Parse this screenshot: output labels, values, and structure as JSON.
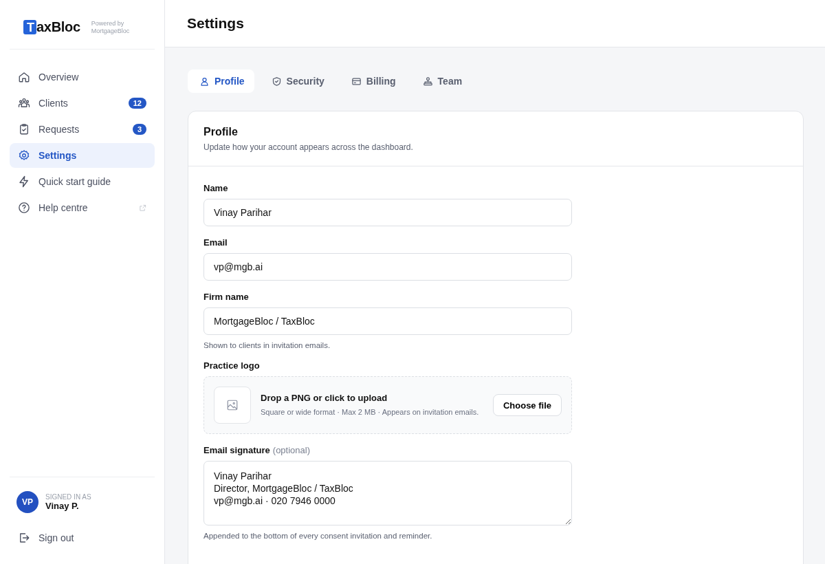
{
  "logo": {
    "mark": "T",
    "text": "axBloc",
    "powered_by": "Powered by",
    "powered_name": "MortgageBloc"
  },
  "nav": [
    {
      "label": "Overview",
      "selected": false,
      "external": false
    },
    {
      "label": "Clients",
      "badge": "12",
      "selected": false,
      "external": false
    },
    {
      "label": "Requests",
      "badge": "3",
      "selected": false,
      "external": false
    },
    {
      "label": "Settings",
      "selected": true,
      "external": false
    },
    {
      "label": "Quick start guide",
      "selected": false,
      "external": false
    },
    {
      "label": "Help centre",
      "selected": false,
      "external": true
    }
  ],
  "user": {
    "initials": "VP",
    "caption": "SIGNED IN AS",
    "name": "Vinay P."
  },
  "sign_out": "Sign out",
  "page_title": "Settings",
  "tabs": [
    {
      "label": "Profile",
      "selected": true
    },
    {
      "label": "Security",
      "selected": false
    },
    {
      "label": "Billing",
      "selected": false
    },
    {
      "label": "Team",
      "selected": false
    }
  ],
  "card": {
    "title": "Profile",
    "subtitle": "Update how your account appears across the dashboard."
  },
  "fields": [
    {
      "kind": "input",
      "label": "Name",
      "value": "Vinay Parihar"
    },
    {
      "kind": "input",
      "label": "Email",
      "value": "vp@mgb.ai"
    },
    {
      "kind": "input",
      "label": "Firm name",
      "value": "MortgageBloc / TaxBloc",
      "help": "Shown to clients in invitation emails."
    },
    {
      "kind": "upload",
      "label": "Practice logo",
      "title": "Drop a PNG or click to upload",
      "description": "Square or wide format · Max 2 MB · Appears on invitation emails.",
      "button": "Choose file"
    },
    {
      "kind": "textarea",
      "label": "Email signature",
      "optional": "(optional)",
      "value": "Vinay Parihar\nDirector, MortgageBloc / TaxBloc\nvp@mgb.ai · 020 7946 0000",
      "help": "Appended to the bottom of every consent invitation and reminder."
    }
  ]
}
